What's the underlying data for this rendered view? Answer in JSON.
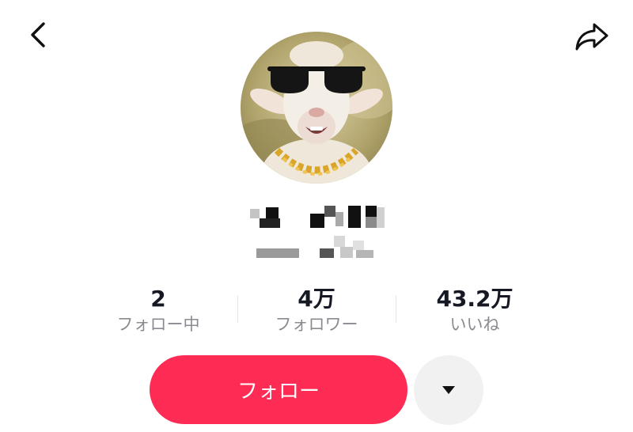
{
  "header": {
    "back_icon": "chevron-left-icon",
    "share_icon": "share-arrow-icon"
  },
  "profile": {
    "avatar": "goat-with-sunglasses-and-gold-chain",
    "name_redacted": true,
    "handle_redacted": true
  },
  "stats": [
    {
      "value": "2",
      "label": "フォロー中"
    },
    {
      "value": "4万",
      "label": "フォロワー"
    },
    {
      "value": "43.2万",
      "label": "いいね"
    }
  ],
  "actions": {
    "follow_label": "フォロー",
    "more_icon": "triangle-down-icon"
  },
  "colors": {
    "accent": "#fe2c55",
    "secondary_button": "#f1f1f2",
    "label": "#8a8b91",
    "text": "#161823"
  }
}
